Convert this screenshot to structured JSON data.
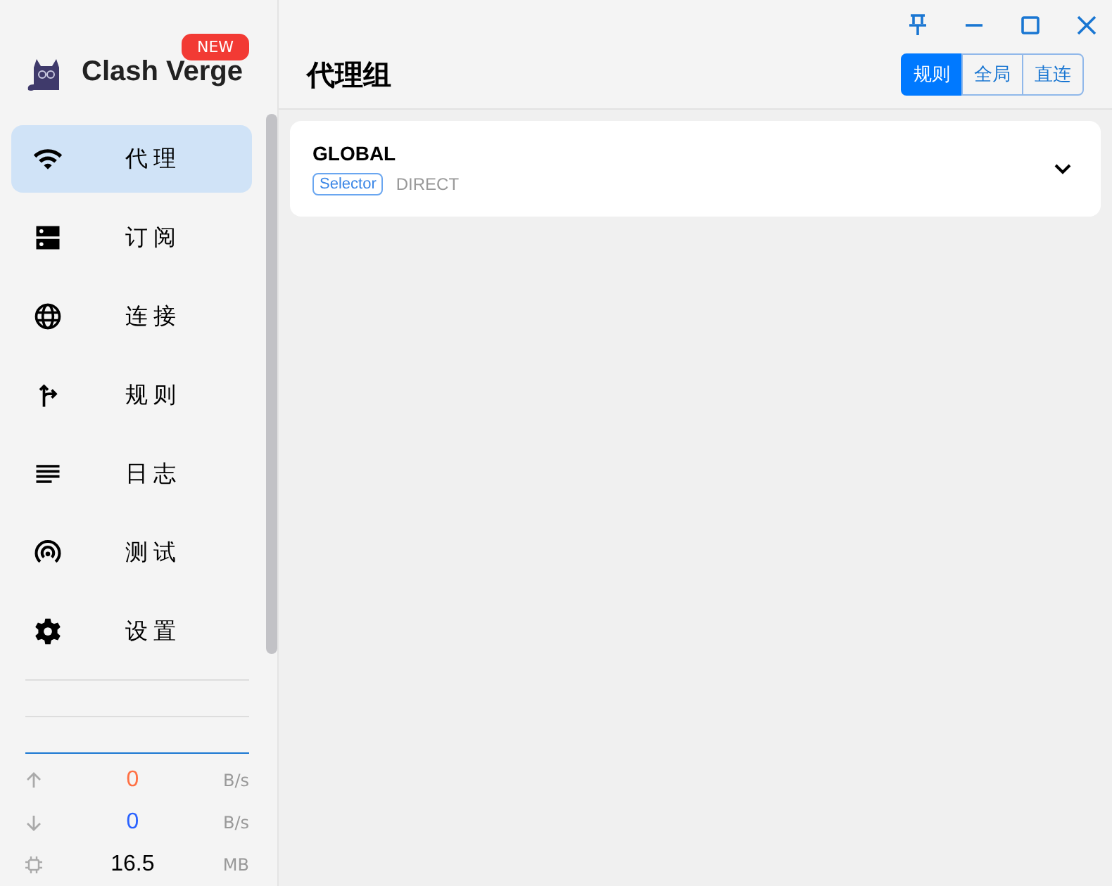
{
  "sidebar": {
    "logo": {
      "name": "Clash Verge",
      "badge": "NEW"
    },
    "items": [
      {
        "label": "代理",
        "kind": "proxy",
        "selected": true
      },
      {
        "label": "订阅",
        "kind": "profiles",
        "selected": false
      },
      {
        "label": "连接",
        "kind": "connections",
        "selected": false
      },
      {
        "label": "规则",
        "kind": "rules",
        "selected": false
      },
      {
        "label": "日志",
        "kind": "logs",
        "selected": false
      },
      {
        "label": "测试",
        "kind": "test",
        "selected": false
      },
      {
        "label": "设置",
        "kind": "settings",
        "selected": false
      }
    ],
    "traffic": [
      {
        "kind": "up",
        "value": "0",
        "unit": "B/s",
        "color": "#ff7043"
      },
      {
        "kind": "down",
        "value": "0",
        "unit": "B/s",
        "color": "#2962ff"
      },
      {
        "kind": "memory",
        "value": "16.5",
        "unit": "MB",
        "color": "#000000"
      }
    ]
  },
  "header": {
    "title": "代理组",
    "modes": [
      {
        "label": "规则",
        "selected": true
      },
      {
        "label": "全局",
        "selected": false
      },
      {
        "label": "直连",
        "selected": false
      }
    ]
  },
  "groups": [
    {
      "name": "GLOBAL",
      "type": "Selector",
      "now": "DIRECT",
      "expanded": false
    }
  ]
}
